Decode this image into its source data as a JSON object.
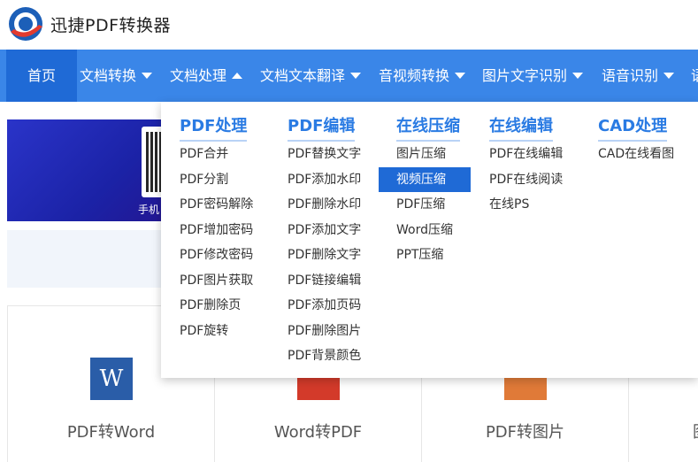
{
  "header": {
    "brand": "迅捷PDF转换器"
  },
  "nav": {
    "items": [
      {
        "label": "首页"
      },
      {
        "label": "文档转换"
      },
      {
        "label": "文档处理"
      },
      {
        "label": "文档文本翻译"
      },
      {
        "label": "音视频转换"
      },
      {
        "label": "图片文字识别"
      },
      {
        "label": "语音识别"
      },
      {
        "label": "语"
      }
    ]
  },
  "banner": {
    "phone_text": "手机"
  },
  "cards": [
    {
      "label": "PDF转Word",
      "icon_text": "W"
    },
    {
      "label": "Word转PDF"
    },
    {
      "label": "PDF转图片"
    },
    {
      "label": "图"
    }
  ],
  "dropdown": {
    "columns": [
      {
        "title": "PDF处理",
        "items": [
          "PDF合并",
          "PDF分割",
          "PDF密码解除",
          "PDF增加密码",
          "PDF修改密码",
          "PDF图片获取",
          "PDF删除页",
          "PDF旋转"
        ]
      },
      {
        "title": "PDF编辑",
        "items": [
          "PDF替换文字",
          "PDF添加水印",
          "PDF删除水印",
          "PDF添加文字",
          "PDF删除文字",
          "PDF链接编辑",
          "PDF添加页码",
          "PDF删除图片",
          "PDF背景颜色"
        ]
      },
      {
        "title": "在线压缩",
        "items": [
          "图片压缩",
          "视频压缩",
          "PDF压缩",
          "Word压缩",
          "PPT压缩"
        ],
        "active_item": "视频压缩"
      },
      {
        "title": "在线编辑",
        "items": [
          "PDF在线编辑",
          "PDF在线阅读",
          "在线PS"
        ]
      },
      {
        "title": "CAD处理",
        "items": [
          "CAD在线看图"
        ]
      }
    ]
  },
  "colors": {
    "nav_bg": "#3a86e8",
    "nav_active": "#1f6ad6",
    "title_blue": "#2a7be3"
  }
}
